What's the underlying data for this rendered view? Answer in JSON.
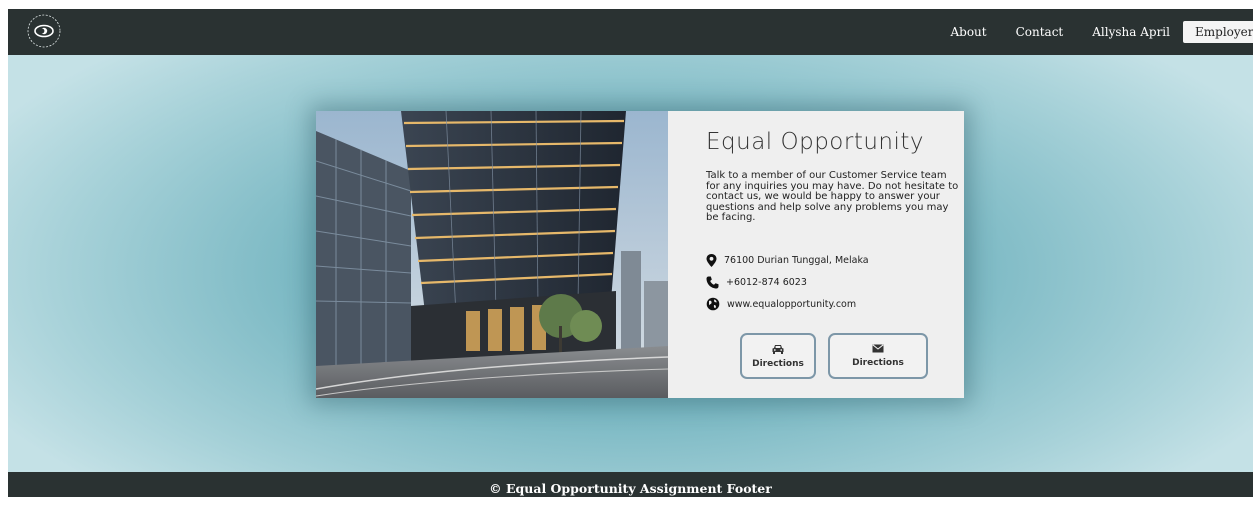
{
  "nav": {
    "links": [
      "About",
      "Contact",
      "Allysha April"
    ],
    "employer_label": "Employer"
  },
  "card": {
    "title": "Equal Opportunity",
    "description": "Talk to a member of our Customer Service team for any inquiries you may have. Do not hesitate to contact us, we would be happy to answer your questions and help solve any problems you may be facing.",
    "address": "76100 Durian Tunggal, Melaka",
    "phone": "+6012-874 6023",
    "website": "www.equalopportunity.com",
    "buttons": [
      {
        "label": "Directions",
        "icon": "car-icon"
      },
      {
        "label": "Directions",
        "icon": "envelope-icon"
      }
    ]
  },
  "footer": {
    "text": "© Equal Opportunity Assignment Footer"
  },
  "colors": {
    "navbar": "#2a3232",
    "hero_center": "#5fa5b1",
    "hero_edge": "#c4e1e6",
    "card_bg": "#efefef",
    "button_border": "#7d97a8"
  }
}
